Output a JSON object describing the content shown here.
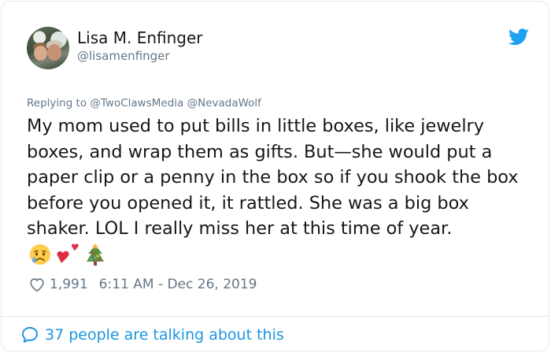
{
  "user": {
    "name": "Lisa M. Enfinger",
    "handle": "@lisamenfinger"
  },
  "reply": {
    "prefix": "Replying to",
    "mentions": [
      "@TwoClawsMedia",
      "@NevadaWolf"
    ]
  },
  "tweet": {
    "text": "My mom used to put bills in little boxes, like jewelry boxes, and wrap them as gifts. But—she would put a paper clip or a penny in the box so if you shook the box before you opened it, it rattled. She was a big box shaker. LOL I really miss her at this time of year.",
    "emojis": [
      "crying-face",
      "two-hearts",
      "christmas-tree"
    ]
  },
  "stats": {
    "likes": "1,991",
    "time": "6:11 AM - Dec 26, 2019"
  },
  "footer": {
    "talking": "37 people are talking about this"
  },
  "colors": {
    "twitter_blue": "#1da1f2",
    "link_blue": "#1b95e0",
    "secondary_text": "#657786",
    "primary_text": "#14171a",
    "border": "#e1e8ed"
  },
  "icons": [
    "twitter-bird-icon",
    "heart-icon",
    "chat-bubble-icon"
  ]
}
